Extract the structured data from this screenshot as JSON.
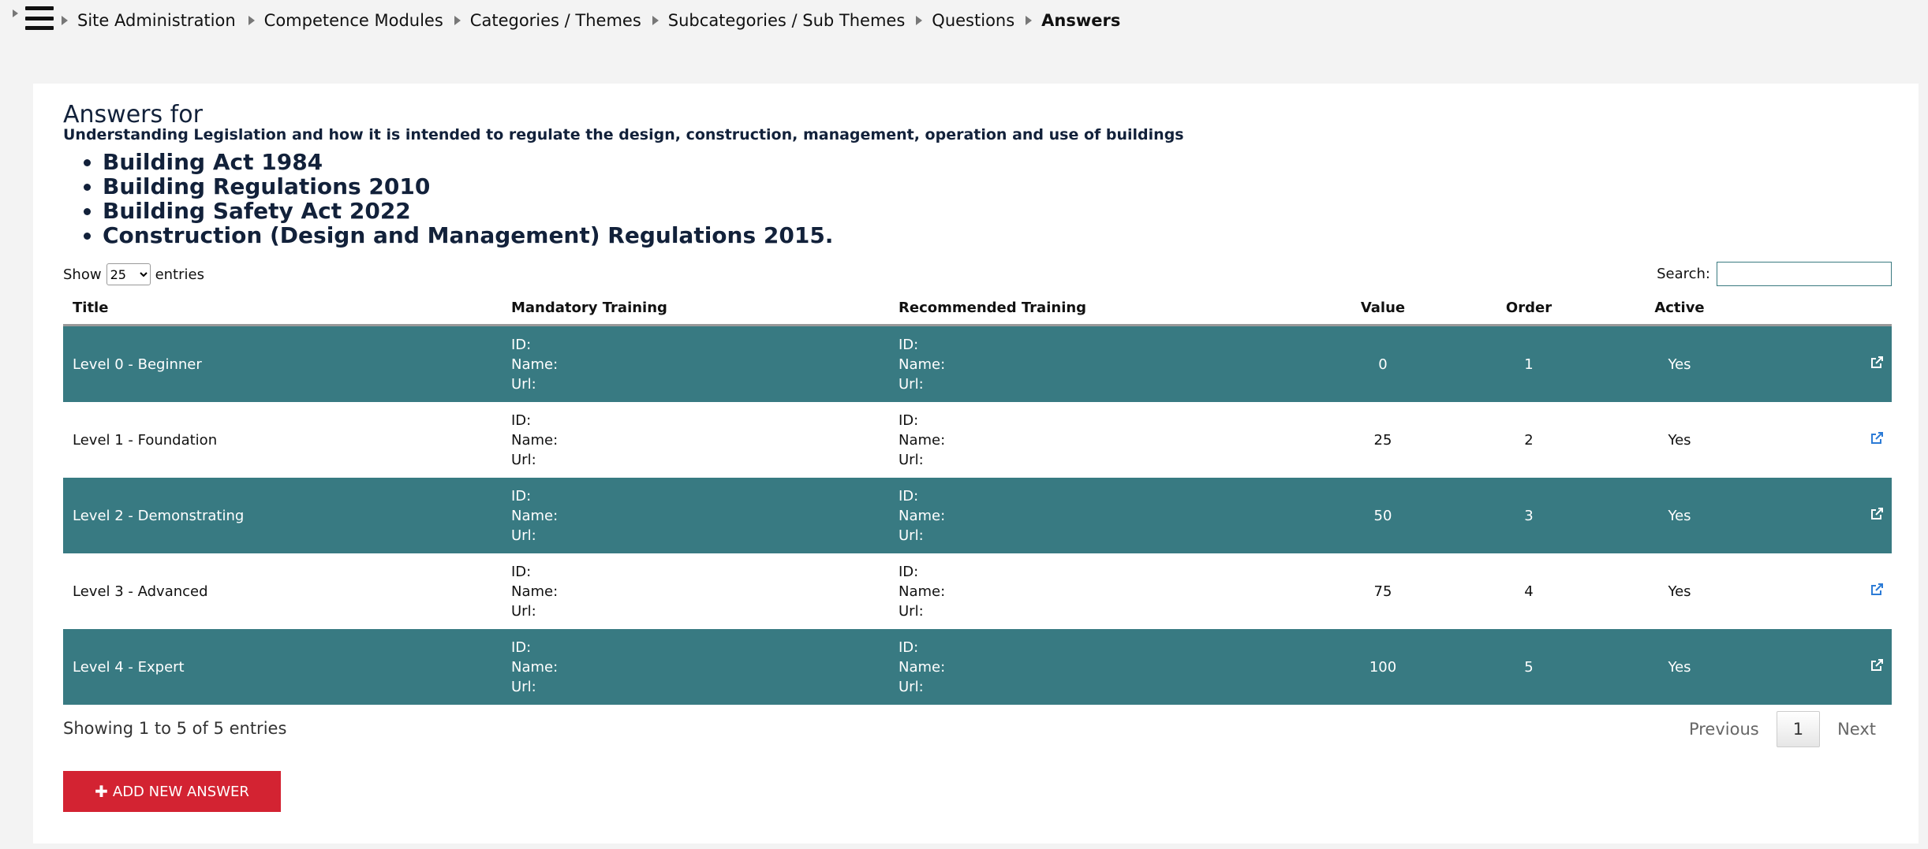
{
  "breadcrumbs": [
    "Site Administration",
    "Competence Modules",
    "Categories / Themes",
    "Subcategories / Sub Themes",
    "Questions",
    "Answers"
  ],
  "heading": "Answers for",
  "subheading": "Understanding Legislation and how it is intended to regulate the design, construction, management, operation and use of buildings",
  "bullets": [
    "Building Act 1984",
    "Building Regulations 2010",
    "Building Safety Act 2022",
    "Construction (Design and Management) Regulations 2015."
  ],
  "length_control": {
    "show": "Show",
    "value": "25",
    "entries": "entries"
  },
  "search": {
    "label": "Search:",
    "value": ""
  },
  "table": {
    "headers": {
      "title": "Title",
      "mandatory": "Mandatory Training",
      "recommended": "Recommended Training",
      "value": "Value",
      "order": "Order",
      "active": "Active"
    },
    "field_labels": {
      "id": "ID:",
      "name": "Name:",
      "url": "Url:"
    },
    "rows": [
      {
        "title": "Level 0 - Beginner",
        "value": "0",
        "order": "1",
        "active": "Yes"
      },
      {
        "title": "Level 1 - Foundation",
        "value": "25",
        "order": "2",
        "active": "Yes"
      },
      {
        "title": "Level 2 - Demonstrating",
        "value": "50",
        "order": "3",
        "active": "Yes"
      },
      {
        "title": "Level 3 - Advanced",
        "value": "75",
        "order": "4",
        "active": "Yes"
      },
      {
        "title": "Level 4 - Expert",
        "value": "100",
        "order": "5",
        "active": "Yes"
      }
    ]
  },
  "info": "Showing 1 to 5 of 5 entries",
  "pager": {
    "previous": "Previous",
    "page": "1",
    "next": "Next"
  },
  "add_button": {
    "icon": "plus-icon",
    "label": "ADD NEW ANSWER"
  },
  "colors": {
    "row_alt": "#387a82",
    "button": "#d32332",
    "link_icon": "#2c7bd6"
  }
}
